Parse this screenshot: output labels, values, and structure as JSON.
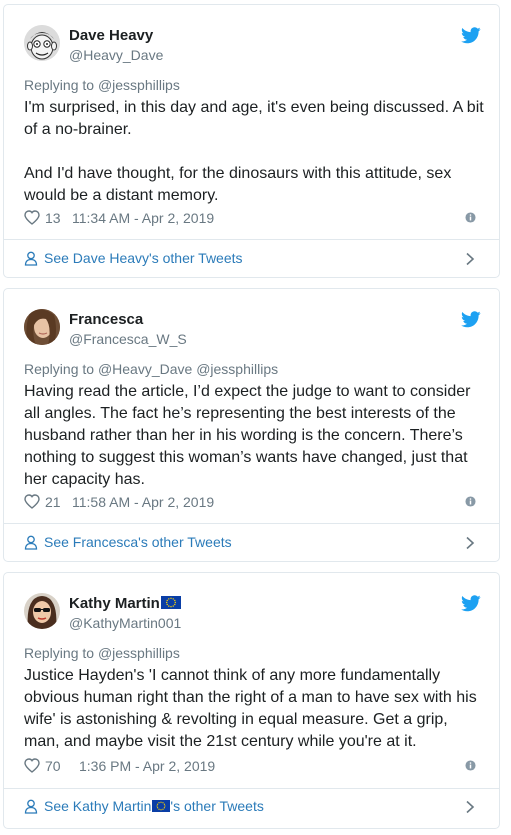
{
  "colors": {
    "link": "#2b7bb9",
    "muted": "#697882",
    "text": "#1c2022",
    "border": "#e1e8ed",
    "twitter_blue": "#1da1f2"
  },
  "tweets": [
    {
      "display_name": "Dave Heavy",
      "handle": "@Heavy_Dave",
      "reply_prefix": "Replying to ",
      "reply_to": "@jessphillips",
      "paragraphs": [
        "I'm surprised, in this day and age, it's even being discussed. A bit of a no-brainer.",
        "And I'd have thought, for the dinosaurs with this attitude, sex would be a distant memory."
      ],
      "likes": "13",
      "timestamp": "11:34 AM - Apr 2, 2019",
      "footer": "See Dave Heavy's other Tweets",
      "icons": {
        "avatar": "avatar-cartoon",
        "bird": "twitter-bird-icon",
        "heart": "heart-icon",
        "info": "info-icon",
        "person": "person-icon",
        "chevron": "chevron-right-icon"
      }
    },
    {
      "display_name": "Francesca",
      "handle": "@Francesca_W_S",
      "reply_prefix": "Replying to ",
      "reply_to": "@Heavy_Dave @jessphillips",
      "paragraphs": [
        "Having read the article, I’d expect the judge to want to consider all angles. The fact he’s representing the best interests of the husband rather than her in his wording is the concern. There’s nothing to suggest this woman’s wants have changed, just that her capacity has."
      ],
      "likes": "21",
      "timestamp": "11:58 AM - Apr 2, 2019",
      "footer": "See Francesca's other Tweets"
    },
    {
      "display_name": "Kathy Martin",
      "handle": "@KathyMartin001",
      "reply_prefix": "Replying to ",
      "reply_to": "@jessphillips",
      "paragraphs": [
        "Justice Hayden's 'I cannot think of any more fundamentally obvious human right than the right of a man to have sex with his wife' is astonishing & revolting in equal measure. Get a grip, man, and maybe visit the 21st century while you're at it."
      ],
      "likes": "70",
      "timestamp": "1:36 PM - Apr 2, 2019",
      "footer_prefix": "See Kathy Martin",
      "footer_suffix": "'s other Tweets",
      "flag_icon": "eu-flag-icon"
    }
  ]
}
